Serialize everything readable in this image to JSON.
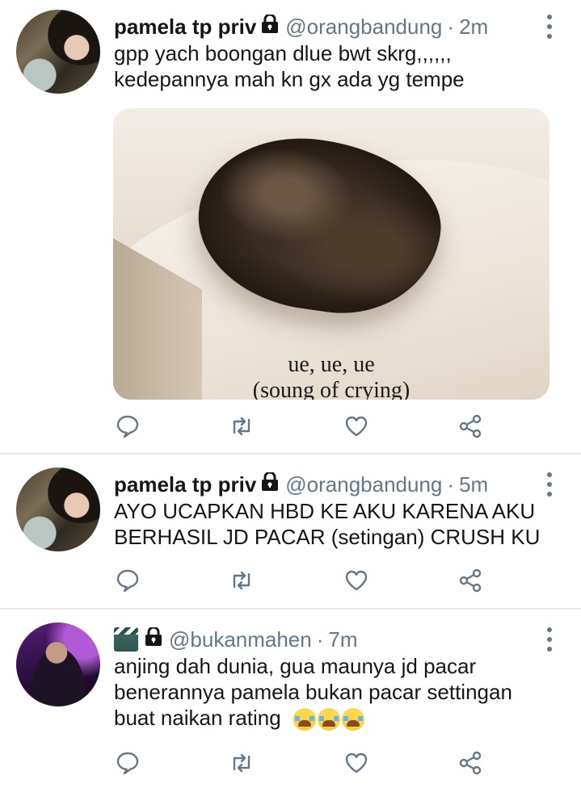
{
  "tweets": [
    {
      "name": "pamela tp priv",
      "handle": "@orangbandung",
      "separator": "·",
      "time": "2m",
      "text_lines": [
        "gpp yach boongan dlue bwt skrg,,,,,,",
        "kedepannya mah kn gx ada yg tempe"
      ],
      "media_caption_lines": [
        "ue, ue, ue",
        "(soung of crying)"
      ]
    },
    {
      "name": "pamela tp priv",
      "handle": "@orangbandung",
      "separator": "·",
      "time": "5m",
      "text_lines": [
        "AYO UCAPKAN HBD KE AKU KARENA AKU",
        "BERHASIL JD PACAR (setingan) CRUSH KU"
      ]
    },
    {
      "name_icon": "clapper-board-icon",
      "handle": "@bukanmahen",
      "separator": "·",
      "time": "7m",
      "text_lines": [
        "anjing dah dunia, gua maunya jd pacar",
        "benerannya pamela bukan pacar settingan",
        "buat naikan rating"
      ],
      "emoji": [
        "loudly-crying-face",
        "loudly-crying-face",
        "loudly-crying-face"
      ]
    }
  ],
  "colors": {
    "text": "#14171a",
    "secondary": "#657786",
    "divider": "#e6ecf0"
  }
}
